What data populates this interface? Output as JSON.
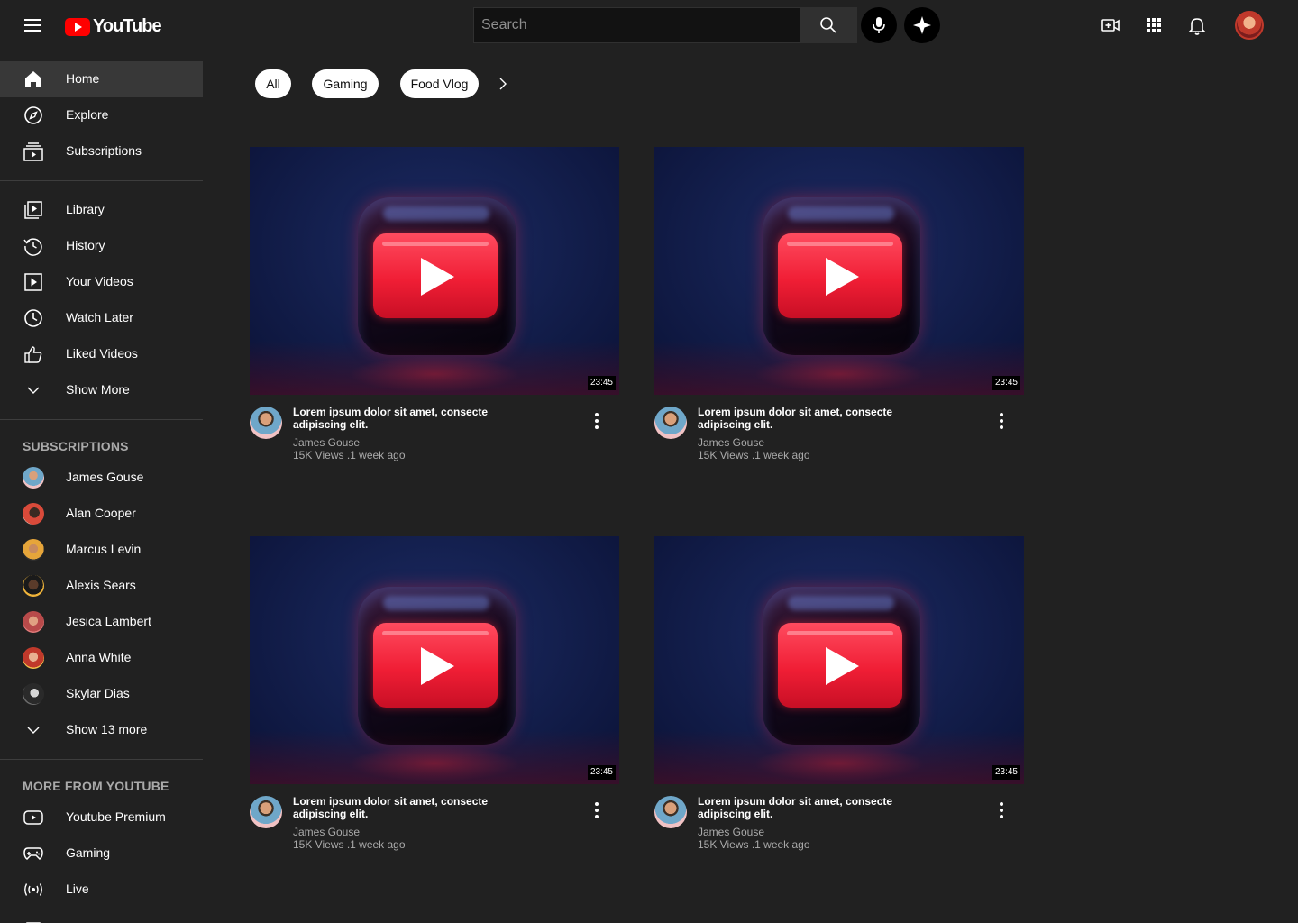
{
  "header": {
    "logo_text": "YouTube",
    "search_placeholder": "Search"
  },
  "sidebar": {
    "main": [
      {
        "label": "Home",
        "icon": "home-icon",
        "active": true
      },
      {
        "label": "Explore",
        "icon": "compass-icon"
      },
      {
        "label": "Subscriptions",
        "icon": "subscriptions-icon"
      }
    ],
    "library": [
      {
        "label": "Library",
        "icon": "library-icon"
      },
      {
        "label": "History",
        "icon": "history-icon"
      },
      {
        "label": "Your Videos",
        "icon": "your-videos-icon"
      },
      {
        "label": "Watch Later",
        "icon": "clock-icon"
      },
      {
        "label": "Liked Videos",
        "icon": "thumbs-up-icon"
      },
      {
        "label": "Show More",
        "icon": "chevron-down-icon"
      }
    ],
    "subscriptions_heading": "SUBSCRIPTIONS",
    "subscriptions": [
      {
        "label": "James Gouse"
      },
      {
        "label": "Alan Cooper"
      },
      {
        "label": "Marcus Levin"
      },
      {
        "label": "Alexis Sears"
      },
      {
        "label": "Jesica Lambert"
      },
      {
        "label": "Anna White"
      },
      {
        "label": "Skylar Dias"
      }
    ],
    "show_more_subs": "Show 13 more",
    "more_heading": "MORE FROM YOUTUBE",
    "more": [
      {
        "label": "Youtube Premium",
        "icon": "premium-icon"
      },
      {
        "label": "Gaming",
        "icon": "gamepad-icon"
      },
      {
        "label": "Live",
        "icon": "live-icon"
      }
    ]
  },
  "chips": [
    "All",
    "Gaming",
    "Food Vlog"
  ],
  "videos": [
    {
      "title": "Lorem ipsum dolor sit amet, consecte adipiscing elit.",
      "channel": "James Gouse",
      "meta": "15K Views .1 week ago",
      "duration": "23:45"
    },
    {
      "title": "Lorem ipsum dolor sit amet, consecte adipiscing elit.",
      "channel": "James Gouse",
      "meta": "15K Views .1 week ago",
      "duration": "23:45"
    },
    {
      "title": "Lorem ipsum dolor sit amet, consecte adipiscing elit.",
      "channel": "James Gouse",
      "meta": "15K Views .1 week ago",
      "duration": "23:45"
    },
    {
      "title": "Lorem ipsum dolor sit amet, consecte adipiscing elit.",
      "channel": "James Gouse",
      "meta": "15K Views .1 week ago",
      "duration": "23:45"
    }
  ],
  "colors": {
    "background": "#212121",
    "active_item": "#383838",
    "brand_red": "#ff0000",
    "secondary_text": "#aaaaaa"
  }
}
